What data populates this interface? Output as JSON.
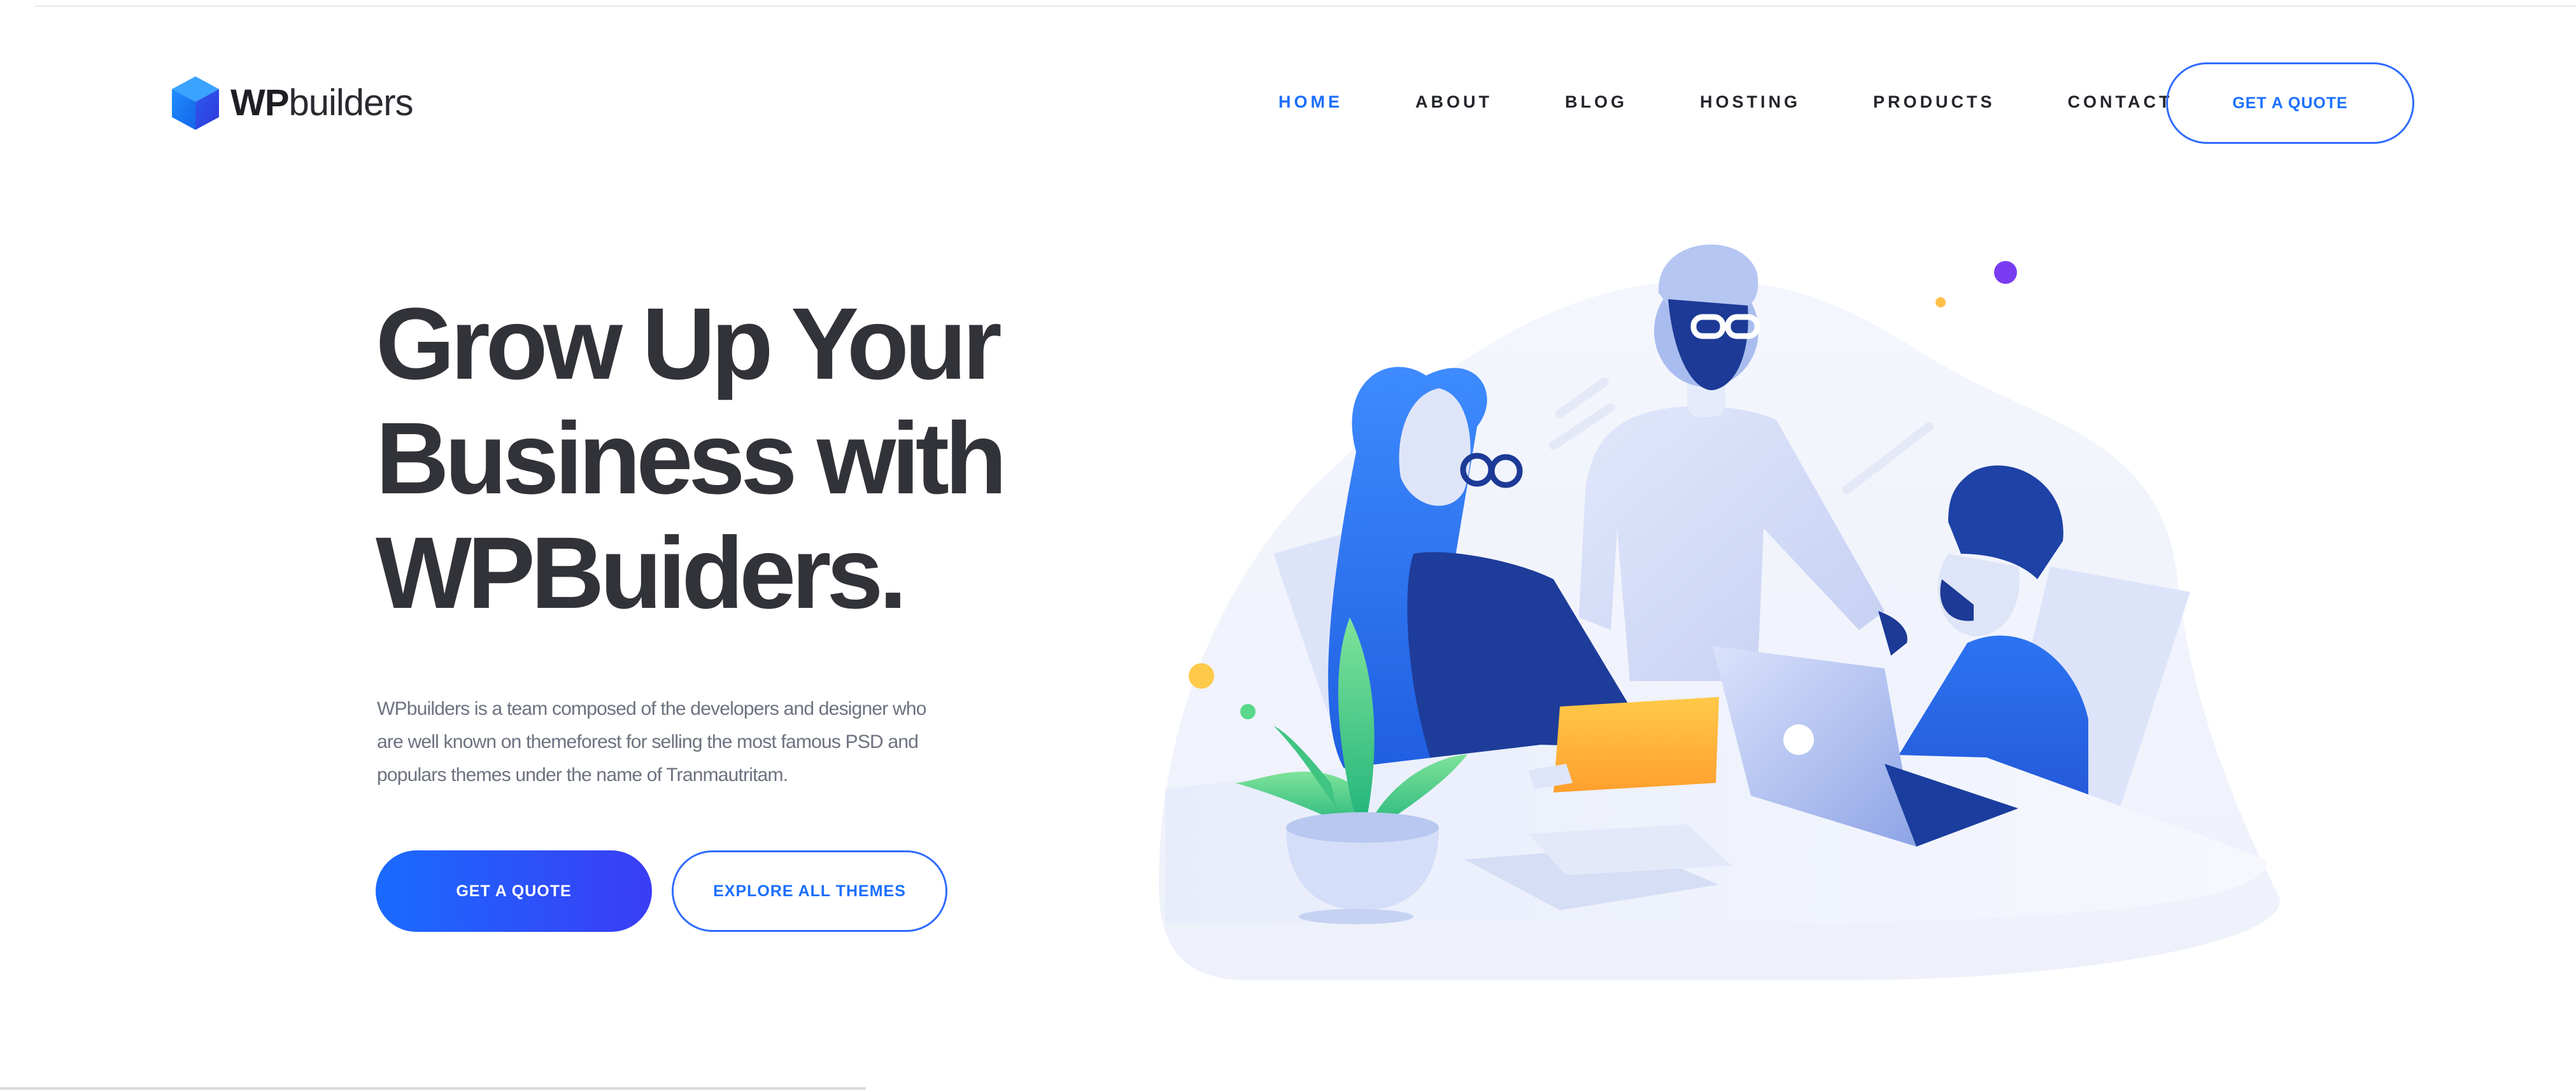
{
  "brand": {
    "name_bold": "WP",
    "name_light": "builders",
    "logo_icon": "cube-icon",
    "accent": "#1b6fff"
  },
  "nav": {
    "items": [
      {
        "label": "HOME",
        "active": true
      },
      {
        "label": "ABOUT",
        "active": false
      },
      {
        "label": "BLOG",
        "active": false
      },
      {
        "label": "HOSTING",
        "active": false
      },
      {
        "label": "PRODUCTS",
        "active": false
      },
      {
        "label": "CONTACT",
        "active": false
      }
    ],
    "quote_button": "GET A QUOTE"
  },
  "hero": {
    "headline_lines": [
      "Grow Up Your",
      "Business with",
      "WPBuiders."
    ],
    "intro_lines": [
      "WPbuilders is a team composed of the developers and designer who",
      "are well known on themeforest for selling the most famous PSD and",
      "populars themes under the name of Tranmautritam."
    ],
    "primary_button": "GET A QUOTE",
    "secondary_button": "EXPLORE ALL THEMES",
    "illustration": "team-meeting-illustration"
  },
  "colors": {
    "heading": "#323338",
    "body_text": "#6d7280",
    "button_gradient_start": "#1a6bff",
    "button_gradient_end": "#3a3df5"
  }
}
